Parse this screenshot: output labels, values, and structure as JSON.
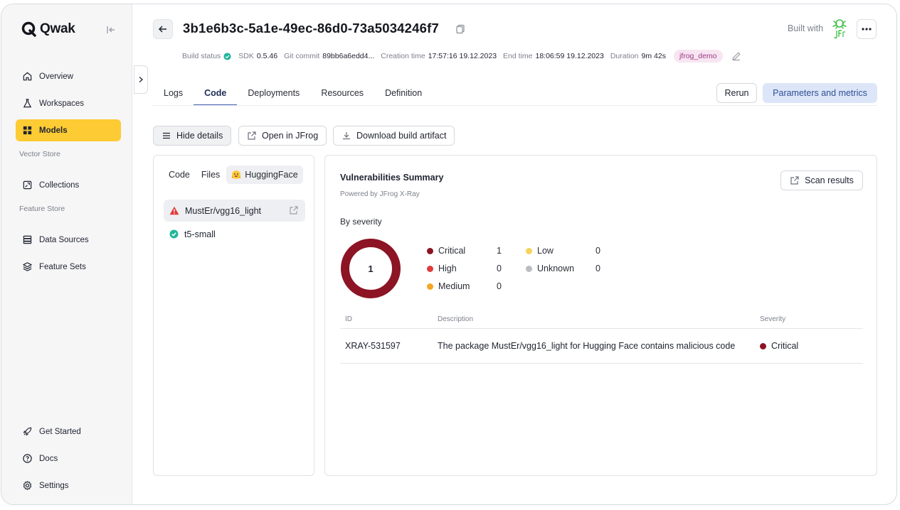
{
  "app": {
    "name": "Qwak"
  },
  "sidebar": {
    "items": [
      {
        "label": "Overview",
        "icon": "home-icon"
      },
      {
        "label": "Workspaces",
        "icon": "flask-icon"
      },
      {
        "label": "Models",
        "icon": "grid-icon"
      },
      {
        "label": "Collections",
        "icon": "collection-icon"
      },
      {
        "label": "Data Sources",
        "icon": "database-icon"
      },
      {
        "label": "Feature Sets",
        "icon": "layers-icon"
      },
      {
        "label": "Get Started",
        "icon": "rocket-icon"
      },
      {
        "label": "Docs",
        "icon": "help-circle-icon"
      },
      {
        "label": "Settings",
        "icon": "gear-icon"
      }
    ],
    "sections": {
      "vector_store": "Vector Store",
      "feature_store": "Feature Store"
    },
    "active": "Models"
  },
  "header": {
    "build_id": "3b1e6b3c-5a1e-49ec-86d0-73a5034246f7",
    "built_with": "Built with",
    "meta": {
      "build_status_label": "Build status",
      "sdk_label": "SDK",
      "sdk_value": "0.5.46",
      "git_label": "Git commit",
      "git_value": "89bb6a6edd4...",
      "creation_label": "Creation time",
      "creation_value": "17:57:16 19.12.2023",
      "end_label": "End time",
      "end_value": "18:06:59 19.12.2023",
      "duration_label": "Duration",
      "duration_value": "9m 42s",
      "tag": "jfrog_demo"
    }
  },
  "tabs": [
    {
      "label": "Logs"
    },
    {
      "label": "Code"
    },
    {
      "label": "Deployments"
    },
    {
      "label": "Resources"
    },
    {
      "label": "Definition"
    }
  ],
  "active_tab": "Code",
  "actions": {
    "rerun": "Rerun",
    "params": "Parameters and metrics",
    "hide_details": "Hide details",
    "open_jfrog": "Open in JFrog",
    "download": "Download build artifact"
  },
  "left_panel": {
    "sub_tabs": [
      "Code",
      "Files",
      "HuggingFace"
    ],
    "active_sub_tab": "HuggingFace",
    "models": [
      {
        "name": "MustEr/vgg16_light",
        "status": "warning",
        "color": "#e03b3b"
      },
      {
        "name": "t5-small",
        "status": "ok",
        "color": "#22b59a"
      }
    ]
  },
  "vulnerabilities": {
    "title": "Vulnerabilities Summary",
    "subtitle": "Powered by JFrog X-Ray",
    "scan_button": "Scan results",
    "by_severity_label": "By severity",
    "total": "1",
    "legend": [
      {
        "name": "Critical",
        "count": "1",
        "color": "#8c1424"
      },
      {
        "name": "High",
        "count": "0",
        "color": "#e03b3b"
      },
      {
        "name": "Medium",
        "count": "0",
        "color": "#f5a623"
      },
      {
        "name": "Low",
        "count": "0",
        "color": "#f7d35c"
      },
      {
        "name": "Unknown",
        "count": "0",
        "color": "#b9bcc3"
      }
    ],
    "table": {
      "headers": [
        "ID",
        "Description",
        "Severity"
      ],
      "rows": [
        {
          "id": "XRAY-531597",
          "description": "The package MustEr/vgg16_light for Hugging Face contains malicious code",
          "severity": "Critical",
          "severity_color": "#8c1424"
        }
      ]
    }
  }
}
